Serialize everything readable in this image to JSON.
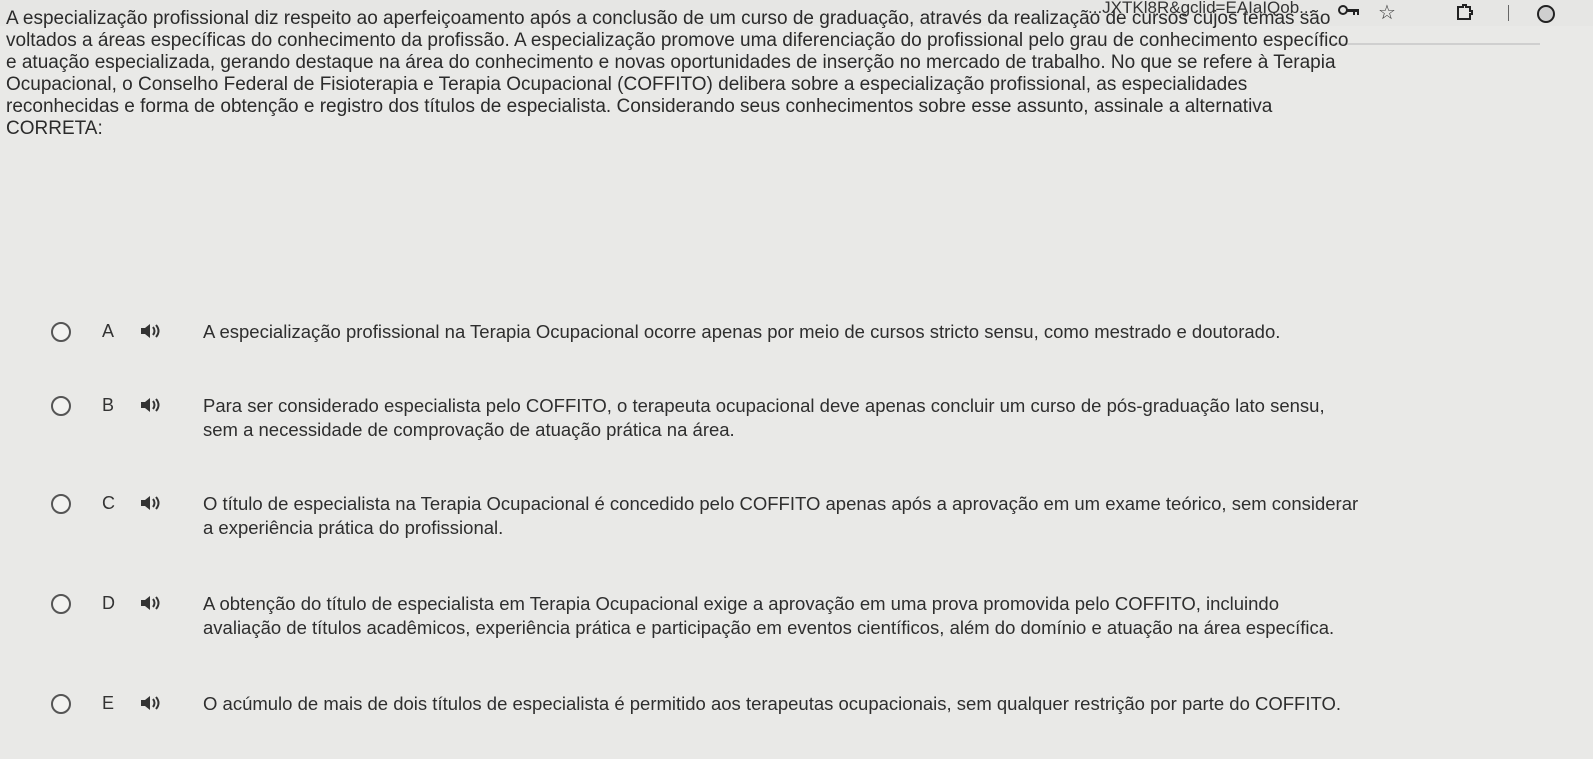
{
  "browser": {
    "url_fragment": "...JXTKl8R&gclid=EAIaIQob...",
    "icons": [
      "key-icon",
      "star-icon",
      "extension-icon",
      "profile-icon"
    ]
  },
  "question": {
    "lines": [
      "A especialização profissional diz respeito ao aperfeiçoamento após a conclusão de um curso de graduação, através da realização de cursos cujos temas são",
      "voltados a áreas específicas do conhecimento da profissão. A especialização promove uma diferenciação do profissional pelo grau de conhecimento específico",
      "e atuação especializada, gerando destaque na área do conhecimento e novas oportunidades de inserção no mercado de trabalho. No que se refere à Terapia",
      "Ocupacional, o Conselho Federal de Fisioterapia e Terapia Ocupacional (COFFITO) delibera sobre a especialização profissional, as especialidades",
      "reconhecidas e forma de obtenção e registro dos títulos de especialista. Considerando seus conhecimentos sobre esse assunto, assinale a alternativa",
      "CORRETA:"
    ]
  },
  "options": [
    {
      "letter": "A",
      "lines": [
        "A especialização profissional na Terapia Ocupacional ocorre apenas por meio de cursos stricto sensu, como mestrado e doutorado."
      ]
    },
    {
      "letter": "B",
      "lines": [
        "Para ser considerado especialista pelo COFFITO, o terapeuta ocupacional deve apenas concluir um curso de pós-graduação lato sensu,",
        "sem a necessidade de comprovação de atuação prática na área."
      ]
    },
    {
      "letter": "C",
      "lines": [
        "O título de especialista na Terapia Ocupacional é concedido pelo COFFITO apenas após a aprovação em um exame teórico, sem considerar",
        "a experiência prática do profissional."
      ]
    },
    {
      "letter": "D",
      "lines": [
        "A obtenção do título de especialista em Terapia Ocupacional exige a aprovação em uma prova promovida pelo COFFITO, incluindo",
        "avaliação de títulos acadêmicos, experiência prática e participação em eventos científicos, além do domínio e atuação na área específica."
      ]
    },
    {
      "letter": "E",
      "lines": [
        "O acúmulo de mais de dois títulos de especialista é permitido aos terapeutas ocupacionais, sem qualquer restrição por parte do COFFITO."
      ]
    }
  ]
}
